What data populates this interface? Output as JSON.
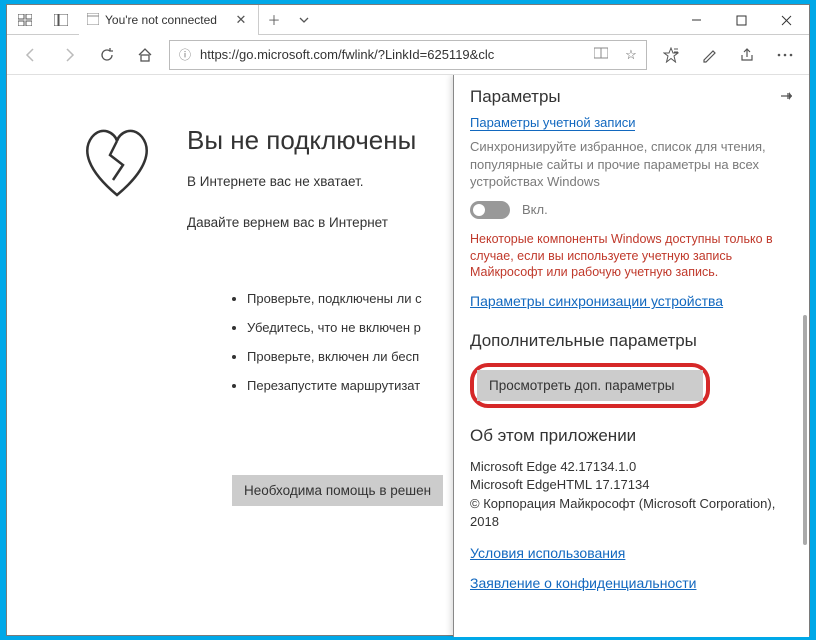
{
  "tab": {
    "title": "You're not connected"
  },
  "addressbar": {
    "url": "https://go.microsoft.com/fwlink/?LinkId=625119&clc"
  },
  "error_page": {
    "heading": "Вы не подключены",
    "line1": "В Интернете вас не хватает.",
    "line2": "Давайте вернем вас в Интернет",
    "bullets": [
      "Проверьте, подключены ли с",
      "Убедитесь, что не включен р",
      "Проверьте, включен ли бесп",
      "Перезапустите маршрутизат"
    ],
    "help_button": "Необходима помощь в решен"
  },
  "settings": {
    "title": "Параметры",
    "account_link": "Параметры учетной записи",
    "sync_desc": "Синхронизируйте избранное, список для чтения, популярные сайты и прочие параметры на всех устройствах Windows",
    "toggle_label": "Вкл.",
    "error_msg": "Некоторые компоненты Windows доступны только в случае, если вы используете учетную запись Майкрософт или рабочую учетную запись.",
    "sync_settings_link": "Параметры синхронизации устройства",
    "advanced_heading": "Дополнительные параметры",
    "advanced_button": "Просмотреть доп. параметры",
    "about_heading": "Об этом приложении",
    "about_body": "Microsoft Edge 42.17134.1.0\nMicrosoft EdgeHTML 17.17134\n© Корпорация Майкрософт (Microsoft Corporation), 2018",
    "terms_link": "Условия использования",
    "privacy_link": "Заявление о конфиденциальности"
  }
}
